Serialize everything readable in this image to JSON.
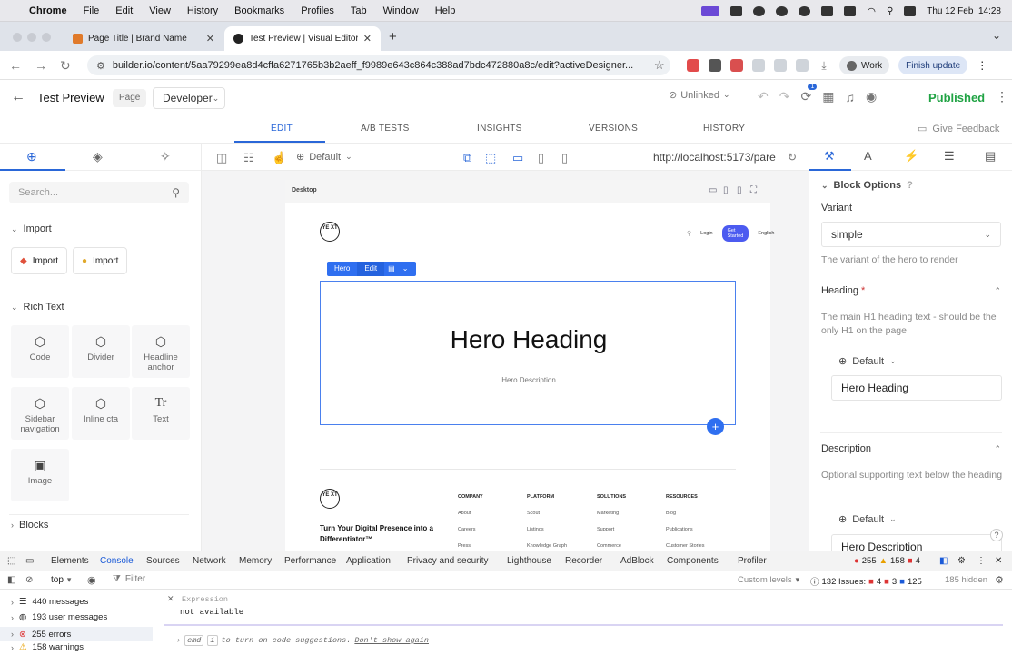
{
  "mac": {
    "app": "Chrome",
    "menu": [
      "File",
      "Edit",
      "View",
      "History",
      "Bookmarks",
      "Profiles",
      "Tab",
      "Window",
      "Help"
    ],
    "datetime": "Thu 12 Feb  14:28"
  },
  "tabs": [
    {
      "title": "Page Title | Brand Name"
    },
    {
      "title": "Test Preview | Visual Editor | B"
    }
  ],
  "address": {
    "url": "builder.io/content/5aa79299ea8d4cffa6271765b3b2aeff_f9989e643c864c388ad7bdc472880a8c/edit?activeDesigner...",
    "profile": "Work",
    "finish_update": "Finish update"
  },
  "header": {
    "title": "Test Preview",
    "page_badge": "Page",
    "env": "Developer",
    "unlinked": "Unlinked",
    "notif_count": "1",
    "published": "Published"
  },
  "editor_tabs": [
    "EDIT",
    "A/B TESTS",
    "INSIGHTS",
    "VERSIONS",
    "HISTORY"
  ],
  "give_feedback": "Give Feedback",
  "left": {
    "search_placeholder": "Search...",
    "import_section": "Import",
    "import_buttons": [
      "Import",
      "Import"
    ],
    "rich_text_section": "Rich Text",
    "blocks": [
      "Code",
      "Divider",
      "Headline anchor",
      "Sidebar navigation",
      "Inline cta",
      "Text",
      "Image"
    ],
    "blocks_section": "Blocks"
  },
  "canvas": {
    "device_default": "Default",
    "url": "http://localhost:5173/pare",
    "frame_label": "Desktop",
    "logo_text": "YE XT",
    "site_nav": [
      "Login",
      "Get Started",
      "English"
    ],
    "hero_chip": "Hero",
    "edit_chip": "Edit",
    "hero_heading": "Hero Heading",
    "hero_description": "Hero Description",
    "footer_tagline": "Turn Your Digital Presence into a Differentiator™",
    "footer_cols": [
      {
        "title": "COMPANY",
        "items": [
          "About",
          "Careers",
          "Press"
        ]
      },
      {
        "title": "PLATFORM",
        "items": [
          "Scout",
          "Listings",
          "Knowledge Graph"
        ]
      },
      {
        "title": "SOLUTIONS",
        "items": [
          "Marketing",
          "Support",
          "Commerce"
        ]
      },
      {
        "title": "RESOURCES",
        "items": [
          "Blog",
          "Publications",
          "Customer Stories"
        ]
      }
    ]
  },
  "right": {
    "block_options": "Block Options",
    "variant_label": "Variant",
    "variant_value": "simple",
    "variant_help": "The variant of the hero to render",
    "heading_label": "Heading",
    "heading_help": "The main H1 heading text - should be the only H1 on the page",
    "default_label": "Default",
    "heading_value": "Hero Heading",
    "description_label": "Description",
    "description_help": "Optional supporting text below the heading",
    "description_value": "Hero Description"
  },
  "devtools": {
    "tabs": [
      "Elements",
      "Console",
      "Sources",
      "Network",
      "Memory",
      "Performance",
      "Application",
      "Privacy and security",
      "Lighthouse",
      "Recorder",
      "AdBlock",
      "Components",
      "Profiler"
    ],
    "errors": "255",
    "warnings": "158",
    "infos": "4",
    "context": "top",
    "filter_placeholder": "Filter",
    "custom_levels": "Custom levels",
    "issues_label": "132 Issues:",
    "issue_counts": [
      "4",
      "3",
      "125"
    ],
    "hidden": "185 hidden",
    "sidebar": [
      "440 messages",
      "193 user messages",
      "255 errors",
      "158 warnings"
    ],
    "expression_label": "Expression",
    "expression_value": "not available",
    "hint_cmd": "cmd",
    "hint_i": "i",
    "hint_text": "to turn on code suggestions.",
    "hint_link": "Don't show again"
  }
}
